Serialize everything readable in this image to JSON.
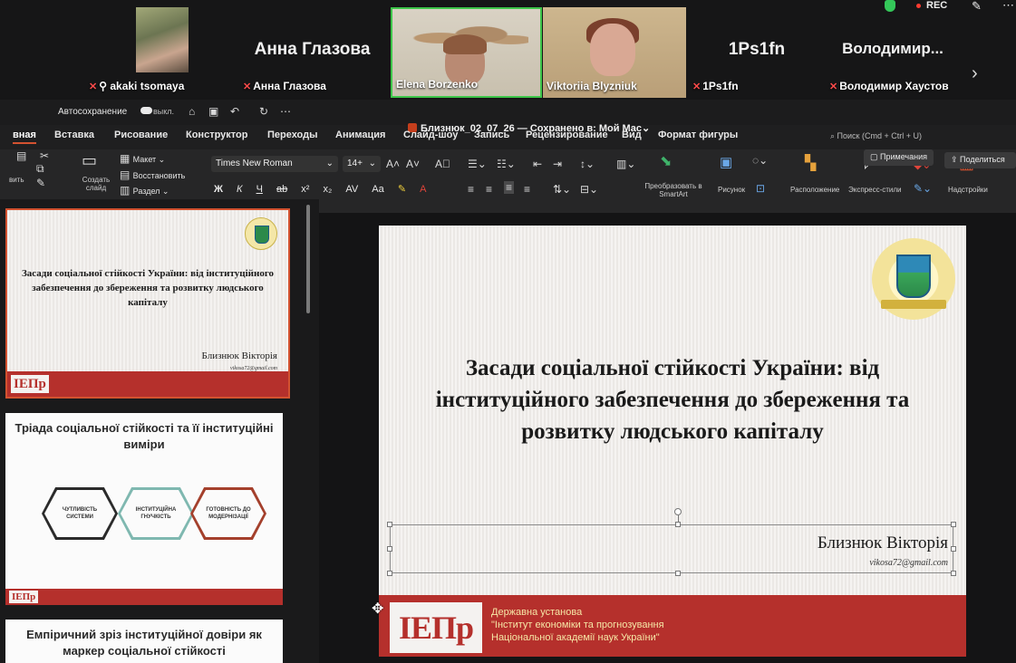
{
  "zoom": {
    "participants": [
      {
        "name": "akaki tsomaya",
        "big_name": "",
        "muted": true,
        "pinned": true
      },
      {
        "name": "Анна Глазова",
        "big_name": "Анна Глазова",
        "muted": true
      },
      {
        "name": "Elena Borzenko",
        "big_name": "",
        "muted": false,
        "active_speaker": true
      },
      {
        "name": "Viktoriia Blyzniuk",
        "big_name": "",
        "muted": false
      },
      {
        "name": "1Ps1fn",
        "big_name": "1Ps1fn",
        "muted": true
      },
      {
        "name": "Володимир Хаустов",
        "big_name": "Володимир...",
        "muted": true
      }
    ],
    "next_icon": "chevron-right-icon",
    "rec_label": "REC",
    "colors": {
      "active_border": "#3ec64a",
      "mute_red": "#ff4b4b",
      "rec_red": "#ff3b30"
    }
  },
  "titlebar": {
    "autosave_label": "Автосохранение",
    "autosave_state": "выкл.",
    "doc_title": "Близнюк_02_07_26 — Сохранено в: Мой Mac"
  },
  "ribbon": {
    "tabs": [
      "Главная",
      "Вставка",
      "Рисование",
      "Конструктор",
      "Переходы",
      "Анимация",
      "Слайд-шоу",
      "Запись",
      "Рецензирование",
      "Вид",
      "Формат фигуры"
    ],
    "tab_home_visible": "вная",
    "search_placeholder": "Поиск (Cmd + Ctrl + U)",
    "comments_label": "Примечания",
    "share_label": "Поделиться",
    "paste_label": "вить",
    "new_slide_label": "Создать слайд",
    "layout_label": "Макет",
    "reset_label": "Восстановить",
    "section_label": "Раздел",
    "font_name": "Times New Roman",
    "font_size": "14+",
    "convert_smartart_label": "Преобразовать в SmartArt",
    "picture_label": "Рисунок",
    "arrange_label": "Расположение",
    "quick_styles_label": "Экспресс-стили",
    "settings_label": "Надстройки",
    "accent": "#d35230"
  },
  "thumbnails": {
    "slide1": {
      "title": "Засади соціальної стійкості України: від інституційного забезпечення до збереження та розвитку людського капіталу",
      "author": "Близнюк Вікторія",
      "email": "vikosa72@gmail.com",
      "footer_logo": "ІЕПр"
    },
    "slide2": {
      "title": "Тріада соціальної стійкості та її інституційні виміри",
      "hex": [
        "ЧУТЛИВІСТЬ СИСТЕМИ",
        "ІНСТИТУЦІЙНА ГНУЧКІСТЬ",
        "ГОТОВНІСТЬ ДО МОДЕРНІЗАЦІЇ"
      ],
      "footer_logo": "ІЕПр"
    },
    "slide3": {
      "title": "Емпіричний зріз інституційної довіри як маркер соціальної стійкості"
    }
  },
  "slide": {
    "title": "Засади соціальної стійкості України: від інституційного забезпечення до збереження та розвитку людського капіталу",
    "author": "Близнюк Вікторія",
    "email": "vikosa72@gmail.com",
    "footer_logo": "ІЕПр",
    "footer_lines": [
      "Державна установа",
      "\"Інститут економіки та прогнозування",
      "Національної академії наук України\""
    ],
    "colors": {
      "footer_red": "#b5302c",
      "footer_text": "#f6e7a6"
    }
  }
}
